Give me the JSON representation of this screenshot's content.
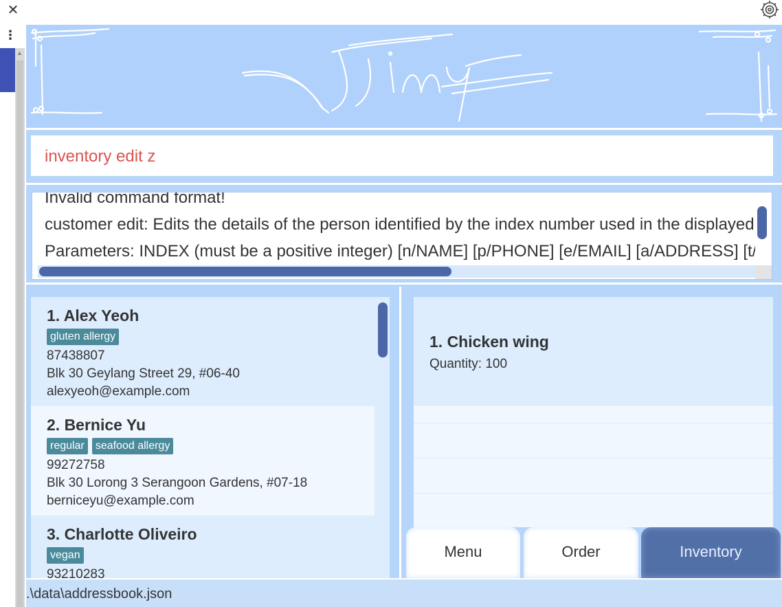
{
  "window": {
    "close_glyph": "✕",
    "menu_glyph": "⋮"
  },
  "banner": {
    "logo_text": "Jimy"
  },
  "command": {
    "value": "inventory edit z"
  },
  "result": {
    "lines": [
      "Invalid command format!",
      "customer edit: Edits the details of the person identified by the index number used in the displayed person list.",
      "Parameters: INDEX (must be a positive integer) [n/NAME] [p/PHONE] [e/EMAIL] [a/ADDRESS] [t/TAG]..."
    ]
  },
  "customers": [
    {
      "name": "1.  Alex Yeoh",
      "tags": [
        "gluten allergy"
      ],
      "phone": "87438807",
      "address": "Blk 30 Geylang Street 29, #06-40",
      "email": "alexyeoh@example.com"
    },
    {
      "name": "2.  Bernice Yu",
      "tags": [
        "regular",
        "seafood allergy"
      ],
      "phone": "99272758",
      "address": "Blk 30 Lorong 3 Serangoon Gardens, #07-18",
      "email": "berniceyu@example.com"
    },
    {
      "name": "3.  Charlotte Oliveiro",
      "tags": [
        "vegan"
      ],
      "phone": "93210283",
      "address": "",
      "email": ""
    }
  ],
  "inventory": {
    "items": [
      {
        "name": "1.  Chicken wing",
        "quantity": "Quantity: 100"
      }
    ]
  },
  "tabs": {
    "menu": "Menu",
    "order": "Order",
    "inventory": "Inventory",
    "active": "inventory",
    "active_color": "#5270a8"
  },
  "status": {
    "path": ".\\data\\addressbook.json"
  },
  "colors": {
    "background": "#b6d5fb",
    "tag": "#4a8a9b",
    "error_text": "#d9534f",
    "scrollbar": "#4b67a7"
  }
}
